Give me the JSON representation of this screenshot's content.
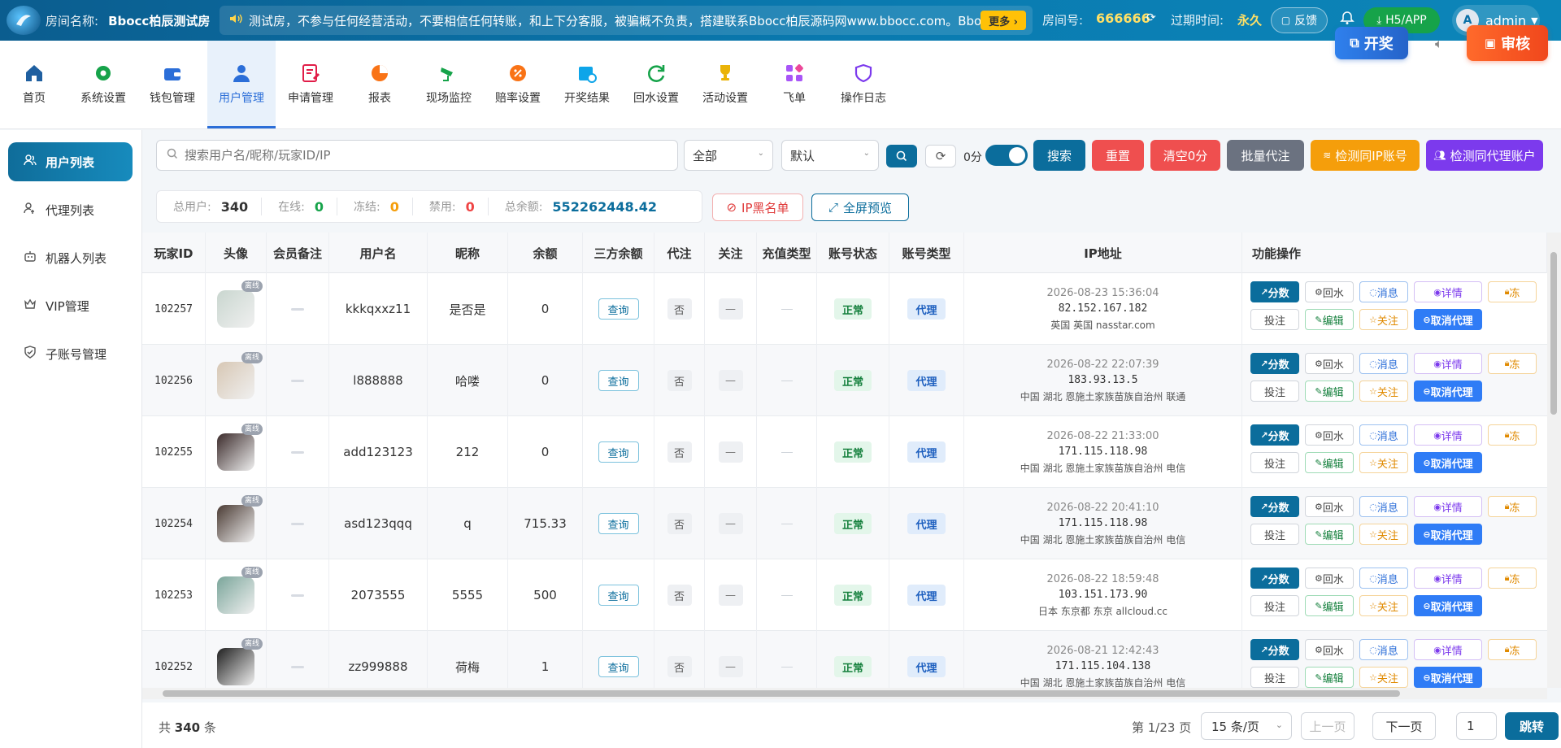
{
  "header": {
    "room_label": "房间名称:",
    "room_name": "Bbocc柏辰测试房",
    "marquee": "测试房，不参与任何经营活动，不要相信任何转账，和上下分客服，被骗概不负责，搭建联系Bbocc柏辰源码网www.bbocc.com。Bbocc",
    "more_label": "更多 ›",
    "room_no_label": "房间号:",
    "room_no": "666666",
    "expire_label": "过期时间:",
    "expire_value": "永久",
    "feedback_label": "反馈",
    "h5_label": "H5/APP",
    "user_initial": "A",
    "user_name": "admin"
  },
  "nav": {
    "items": [
      {
        "label": "首页",
        "icon": "home-icon",
        "color": "#1f5fa0"
      },
      {
        "label": "系统设置",
        "icon": "gear-icon",
        "color": "#16a34a"
      },
      {
        "label": "钱包管理",
        "icon": "wallet-icon",
        "color": "#2b6ed8"
      },
      {
        "label": "用户管理",
        "icon": "user-icon",
        "color": "#2b6ed8"
      },
      {
        "label": "申请管理",
        "icon": "edit-doc-icon",
        "color": "#e11d48"
      },
      {
        "label": "报表",
        "icon": "pie-chart-icon",
        "color": "#f97316"
      },
      {
        "label": "现场监控",
        "icon": "camera-icon",
        "color": "#16a34a"
      },
      {
        "label": "赔率设置",
        "icon": "percent-icon",
        "color": "#f97316"
      },
      {
        "label": "开奖结果",
        "icon": "calendar-icon",
        "color": "#0ea5e9"
      },
      {
        "label": "回水设置",
        "icon": "refresh-icon",
        "color": "#16a34a"
      },
      {
        "label": "活动设置",
        "icon": "trophy-icon",
        "color": "#eab308"
      },
      {
        "label": "飞单",
        "icon": "grid-icon",
        "color": "#a855f7"
      },
      {
        "label": "操作日志",
        "icon": "shield-icon",
        "color": "#7c3aed"
      }
    ],
    "draw_label": "开奖",
    "audit_label": "审核"
  },
  "sidebar": {
    "items": [
      {
        "label": "用户列表",
        "icon": "users-icon"
      },
      {
        "label": "代理列表",
        "icon": "agent-icon"
      },
      {
        "label": "机器人列表",
        "icon": "robot-icon"
      },
      {
        "label": "VIP管理",
        "icon": "crown-icon"
      },
      {
        "label": "子账号管理",
        "icon": "shield-check-icon"
      }
    ]
  },
  "filters": {
    "search_placeholder": "搜索用户名/昵称/玩家ID/IP",
    "select_all": "全部",
    "select_sort": "默认",
    "zero_label": "0分",
    "search_btn": "搜索",
    "reset_btn": "重置",
    "clear_zero_btn": "清空0分",
    "batch_agent_btn": "批量代注",
    "check_ip_btn": "检测同IP账号",
    "check_agent_btn": "检测同代理账户"
  },
  "stats": {
    "total_label": "总用户:",
    "total": "340",
    "online_label": "在线:",
    "online": "0",
    "frozen_label": "冻结:",
    "frozen": "0",
    "banned_label": "禁用:",
    "banned": "0",
    "balance_label": "总余额:",
    "balance": "552262448.42",
    "ip_blacklist": "IP黑名单",
    "fullscreen": "全屏预览"
  },
  "table": {
    "headers": [
      "玩家ID",
      "头像",
      "会员备注",
      "用户名",
      "昵称",
      "余额",
      "三方余额",
      "代注",
      "关注",
      "充值类型",
      "账号状态",
      "账号类型",
      "IP地址",
      "功能操作"
    ],
    "offline_badge": "离线",
    "query_label": "查询",
    "no_label": "否",
    "dash_label": "—",
    "status_label": "正常",
    "type_label": "代理",
    "ops": {
      "score": "分数",
      "back": "回水",
      "msg": "消息",
      "detail": "详情",
      "lock": "冻",
      "bet": "投注",
      "edit": "编辑",
      "follow": "关注",
      "cancel": "取消代理"
    },
    "rows": [
      {
        "id": "102257",
        "username": "kkkqxxz11",
        "nickname": "是否是",
        "balance": "0",
        "time": "2026-08-23 15:36:04",
        "ip": "82.152.167.182",
        "loc": "英国 英国 nasstar.com",
        "avatar": "#c9d6cf"
      },
      {
        "id": "102256",
        "username": "l888888",
        "nickname": "哈喽",
        "balance": "0",
        "time": "2026-08-22 22:07:39",
        "ip": "183.93.13.5",
        "loc": "中国 湖北 恩施土家族苗族自治州 联通",
        "avatar": "#d7c7b4"
      },
      {
        "id": "102255",
        "username": "add123123",
        "nickname": "212",
        "balance": "0",
        "time": "2026-08-22 21:33:00",
        "ip": "171.115.118.98",
        "loc": "中国 湖北 恩施土家族苗族自治州 电信",
        "avatar": "#3a2a2a"
      },
      {
        "id": "102254",
        "username": "asd123qqq",
        "nickname": "q",
        "balance": "715.33",
        "time": "2026-08-22 20:41:10",
        "ip": "171.115.118.98",
        "loc": "中国 湖北 恩施土家族苗族自治州 电信",
        "avatar": "#4a3a33"
      },
      {
        "id": "102253",
        "username": "2073555",
        "nickname": "5555",
        "balance": "500",
        "time": "2026-08-22 18:59:48",
        "ip": "103.151.173.90",
        "loc": "日本 东京都 东京 allcloud.cc",
        "avatar": "#7aa59a"
      },
      {
        "id": "102252",
        "username": "zz999888",
        "nickname": "荷梅",
        "balance": "1",
        "time": "2026-08-21 12:42:43",
        "ip": "171.115.104.138",
        "loc": "中国 湖北 恩施土家族苗族自治州 电信",
        "avatar": "#1f1f1f"
      }
    ]
  },
  "pager": {
    "total_prefix": "共",
    "total": "340",
    "total_suffix": "条",
    "page_info": "第 1/23 页",
    "per_page": "15 条/页",
    "prev": "上一页",
    "next": "下一页",
    "page_input": "1",
    "jump": "跳转"
  }
}
